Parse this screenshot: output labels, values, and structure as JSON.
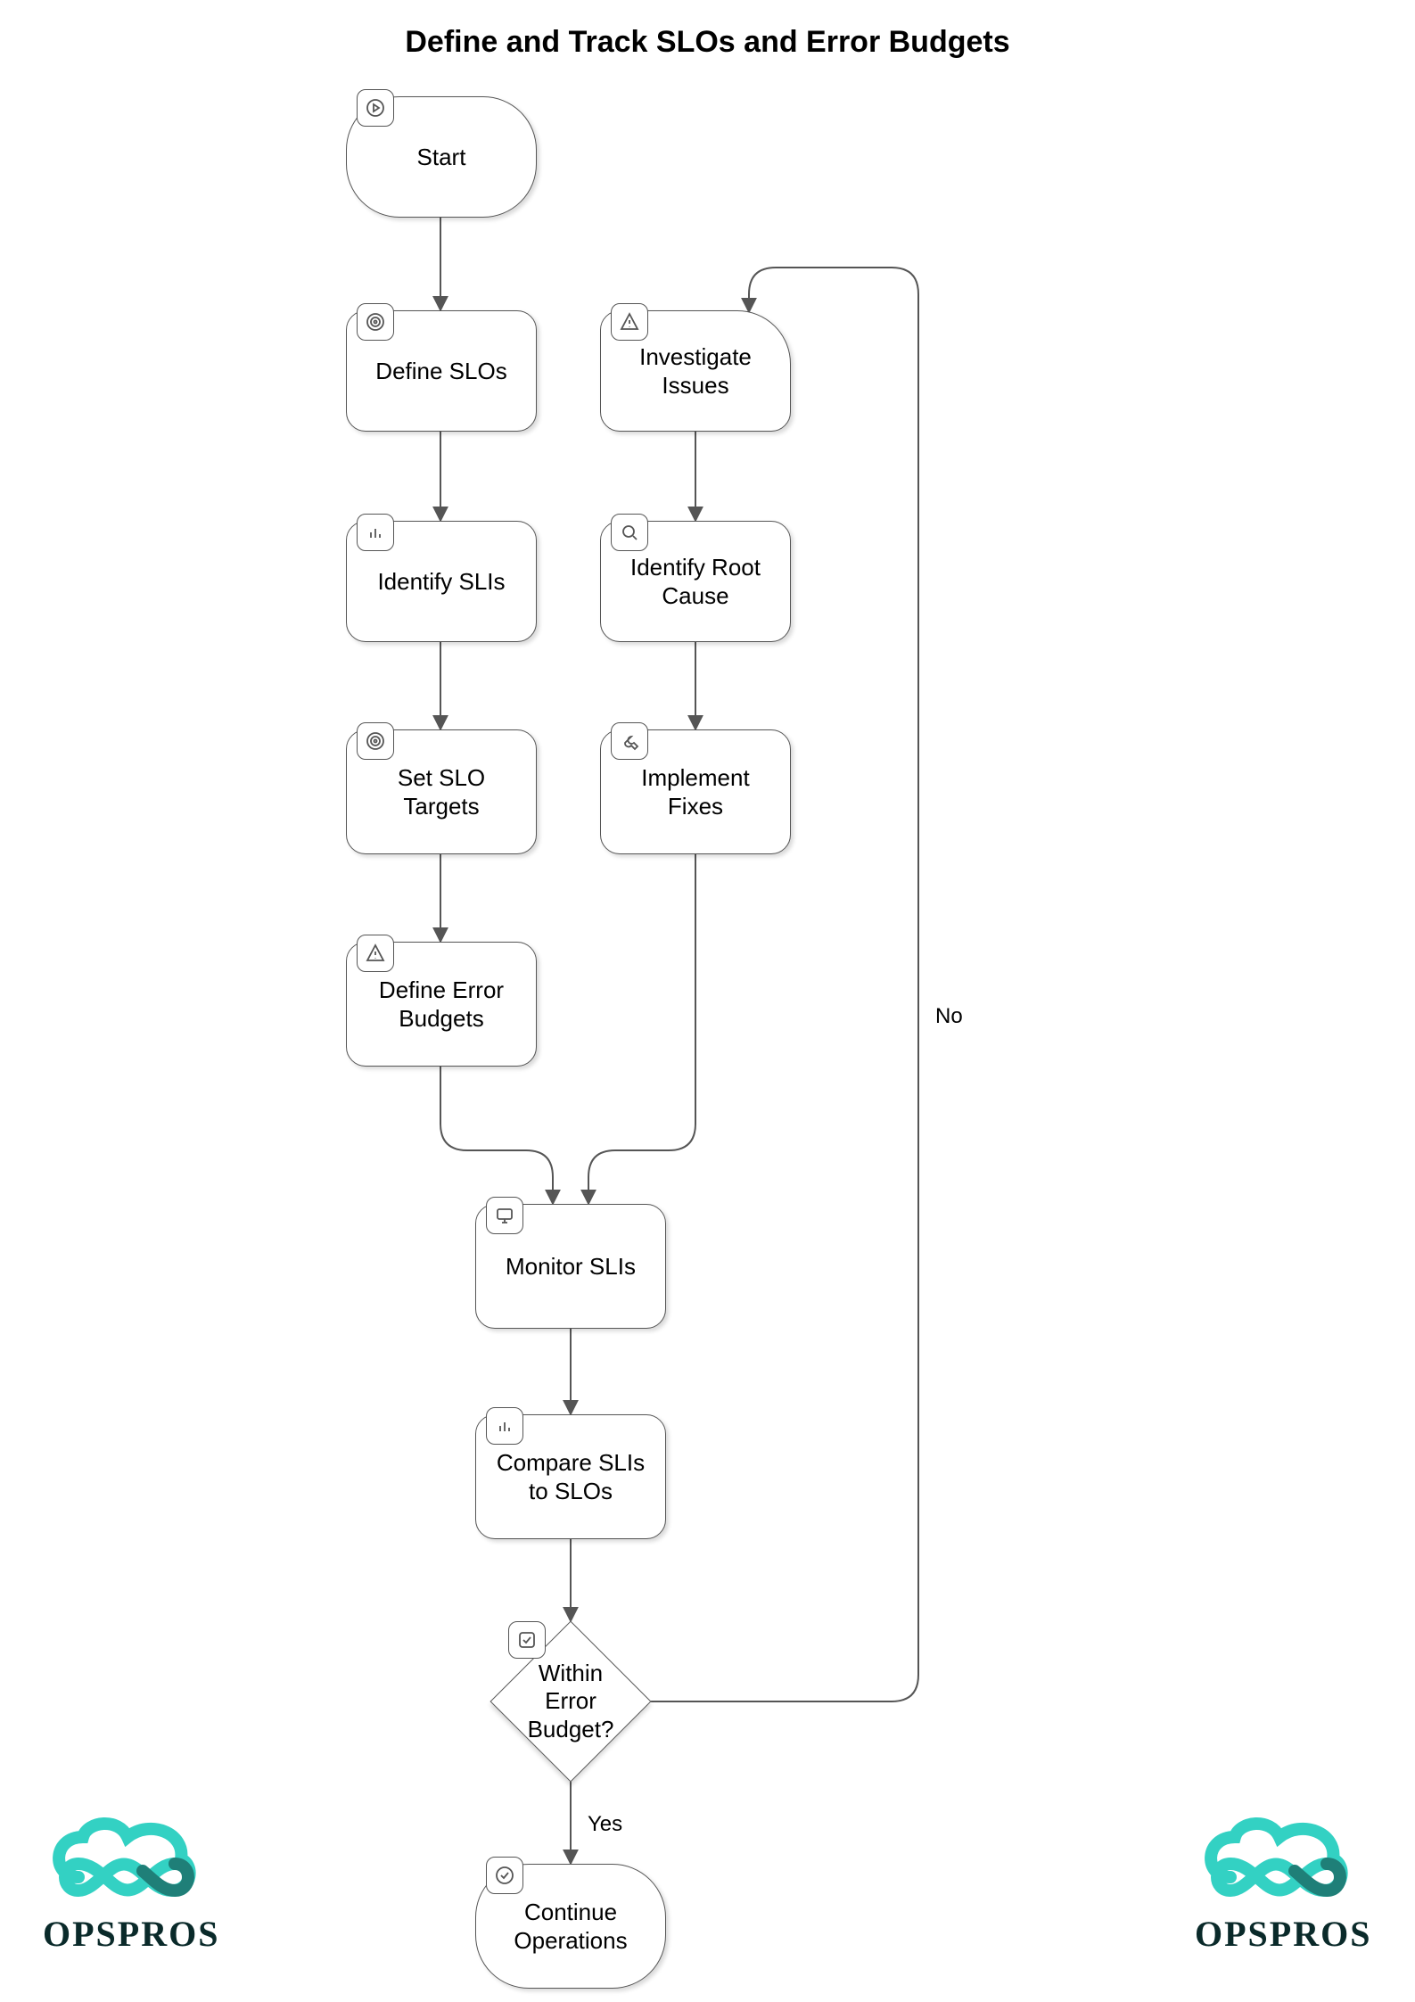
{
  "title": "Define and Track SLOs and Error Budgets",
  "nodes": {
    "start": "Start",
    "define_slos": "Define SLOs",
    "identify_slis": "Identify SLIs",
    "set_targets": "Set SLO\nTargets",
    "define_budgets": "Define Error\nBudgets",
    "investigate": "Investigate\nIssues",
    "root_cause": "Identify Root\nCause",
    "implement_fixes": "Implement\nFixes",
    "monitor": "Monitor SLIs",
    "compare": "Compare SLIs\nto SLOs",
    "within_budget": "Within\nError\nBudget?",
    "continue_ops": "Continue\nOperations"
  },
  "edges": {
    "yes": "Yes",
    "no": "No"
  },
  "brand": {
    "name": "OPSPROS",
    "accent": "#33d1c3",
    "accent_dark": "#1f7f78"
  }
}
